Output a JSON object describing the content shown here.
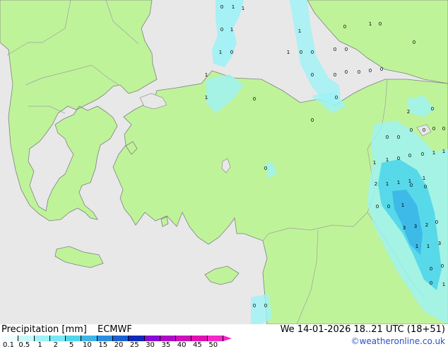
{
  "legend": {
    "title": "Precipitation [mm]",
    "model": "ECMWF",
    "labels": [
      "0.1",
      "0.5",
      "1",
      "2",
      "5",
      "10",
      "15",
      "20",
      "25",
      "30",
      "35",
      "40",
      "45",
      "50"
    ],
    "colors": [
      "#f0fefe",
      "#c8fafa",
      "#9ef2f6",
      "#78e8f2",
      "#50d6ea",
      "#3cb6e8",
      "#2a8ee0",
      "#1c60d4",
      "#0e2aba",
      "#8a0ad4",
      "#b00ac8",
      "#cc10bc",
      "#e010b4",
      "#f428c8"
    ]
  },
  "datetime": "We 14-01-2026 18..21 UTC (18+51)",
  "credit": "©weatheronline.co.uk",
  "map": {
    "sea_color": "#e8e8e8",
    "land_color": "#bff39a",
    "border_color": "#a0a0a0",
    "coast_color": "#808080",
    "precip_values": [
      "0",
      "1",
      "1",
      "0",
      "1",
      "1",
      "0",
      "1",
      "1",
      "0",
      "1",
      "1",
      "0",
      "0",
      "0",
      "0",
      "0",
      "0",
      "0",
      "0",
      "0",
      "0",
      "0",
      "1",
      "0",
      "0",
      "0",
      "0",
      "2",
      "0",
      "0",
      "0",
      "0",
      "0",
      "0",
      "0",
      "1",
      "1",
      "0",
      "0",
      "0",
      "1",
      "1",
      "1",
      "1",
      "1",
      "1",
      "2",
      "0",
      "0",
      "1",
      "3",
      "3",
      "2",
      "0",
      "1",
      "1",
      "3",
      "0",
      "0",
      "0",
      "1",
      "0",
      "0",
      "0",
      "0",
      "0"
    ]
  }
}
